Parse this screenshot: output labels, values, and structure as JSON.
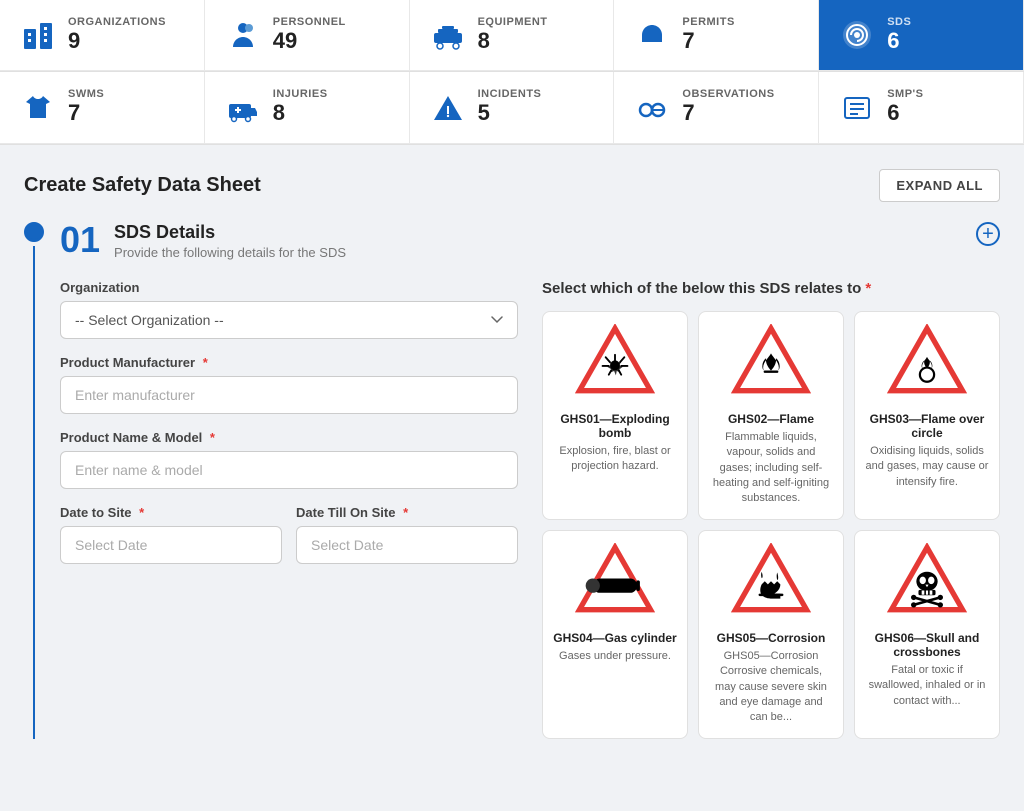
{
  "stats": {
    "row1": [
      {
        "id": "organizations",
        "label": "ORGANIZATIONS",
        "value": "9",
        "icon": "buildings",
        "active": false
      },
      {
        "id": "personnel",
        "label": "PERSONNEL",
        "value": "49",
        "icon": "person",
        "active": false
      },
      {
        "id": "equipment",
        "label": "EQUIPMENT",
        "value": "8",
        "icon": "equipment",
        "active": false
      },
      {
        "id": "permits",
        "label": "PERMITS",
        "value": "7",
        "icon": "helmet",
        "active": false
      },
      {
        "id": "sds",
        "label": "SDS",
        "value": "6",
        "icon": "sds",
        "active": true
      }
    ],
    "row2": [
      {
        "id": "swms",
        "label": "SWMS",
        "value": "7",
        "icon": "shirt",
        "active": false
      },
      {
        "id": "injuries",
        "label": "INJURIES",
        "value": "8",
        "icon": "ambulance",
        "active": false
      },
      {
        "id": "incidents",
        "label": "INCIDENTS",
        "value": "5",
        "icon": "warning",
        "active": false
      },
      {
        "id": "observations",
        "label": "OBSERVATIONS",
        "value": "7",
        "icon": "glasses",
        "active": false
      },
      {
        "id": "smps",
        "label": "SMP'S",
        "value": "6",
        "icon": "list",
        "active": false
      }
    ]
  },
  "page": {
    "title": "Create Safety Data Sheet",
    "expand_button": "EXPAND ALL"
  },
  "step": {
    "number": "01",
    "title": "SDS Details",
    "subtitle": "Provide the following details for the SDS"
  },
  "form": {
    "organization_label": "Organization",
    "organization_placeholder": "-- Select Organization --",
    "manufacturer_label": "Product Manufacturer",
    "manufacturer_placeholder": "Enter manufacturer",
    "product_label": "Product Name & Model",
    "product_placeholder": "Enter name & model",
    "date_to_site_label": "Date to Site",
    "date_to_site_placeholder": "Select Date",
    "date_till_label": "Date Till On Site",
    "date_till_placeholder": "Select Date",
    "ghs_title": "Select which of the below this SDS relates to"
  },
  "ghs_hazards": [
    {
      "id": "ghs01",
      "name": "GHS01—Exploding bomb",
      "description": "Explosion, fire, blast or projection hazard.",
      "icon": "explosion"
    },
    {
      "id": "ghs02",
      "name": "GHS02—Flame",
      "description": "Flammable liquids, vapour, solids and gases; including self-heating and self-igniting substances.",
      "icon": "flame"
    },
    {
      "id": "ghs03",
      "name": "GHS03—Flame over circle",
      "description": "Oxidising liquids, solids and gases, may cause or intensify fire.",
      "icon": "flame-circle"
    },
    {
      "id": "ghs04",
      "name": "GHS04—Gas cylinder",
      "description": "Gases under pressure.",
      "icon": "gas-cylinder"
    },
    {
      "id": "ghs05",
      "name": "GHS05—Corrosion",
      "description": "GHS05—Corrosion\nCorrosive chemicals, may cause severe skin and eye damage and can be...",
      "icon": "corrosion"
    },
    {
      "id": "ghs06",
      "name": "GHS06—Skull and crossbones",
      "description": "Fatal or toxic if swallowed, inhaled or in contact with...",
      "icon": "skull"
    }
  ]
}
